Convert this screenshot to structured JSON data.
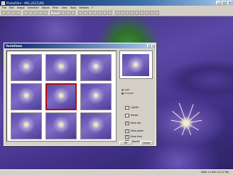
{
  "window": {
    "title": "PhotoFiltre - IMG_0123.JPG",
    "buttons": {
      "minimize": "_",
      "maximize": "□",
      "close": "×"
    }
  },
  "menu": [
    "File",
    "Edit",
    "Image",
    "Selection",
    "Adjust",
    "Filter",
    "View",
    "Tools",
    "Window",
    "?"
  ],
  "toolbar": {
    "zoom": "100%"
  },
  "status": {
    "text": "1800 x 1200   12.27 Mo"
  },
  "dialog": {
    "title": "Variations",
    "help_btn": "?",
    "close_btn": "×",
    "radio_options": [
      {
        "label": "Light",
        "checked": false
      },
      {
        "label": "Contrast",
        "checked": true
      }
    ],
    "adjustments": [
      {
        "icon": "+",
        "label": "Lighter"
      },
      {
        "icon": "-",
        "label": "Darker"
      },
      {
        "icon": "R",
        "label": "More red"
      },
      {
        "icon": "G",
        "label": "More green"
      },
      {
        "icon": "B",
        "label": "More blue"
      },
      {
        "icon": "S",
        "label": "Saturation"
      }
    ],
    "ok_label": "OK",
    "cancel_label": "Cancel"
  },
  "colors": {
    "titlebar": "#0a246a",
    "selection": "#b01010",
    "chrome": "#d4d0c8"
  }
}
